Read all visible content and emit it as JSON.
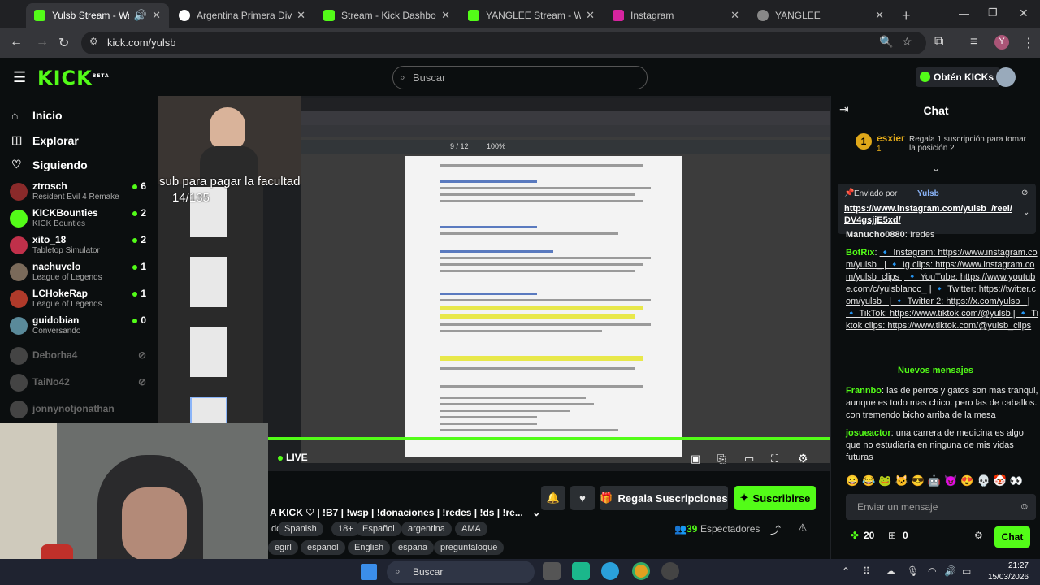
{
  "browser": {
    "tabs": [
      {
        "title": "Yulsb Stream - Watch L",
        "active": true
      },
      {
        "title": "Argentina Primera Division"
      },
      {
        "title": "Stream - Kick Dashboard"
      },
      {
        "title": "YANGLEE Stream - Watch L"
      },
      {
        "title": "Instagram"
      },
      {
        "title": "YANGLEE"
      }
    ],
    "new_tab": "+",
    "url": "kick.com/yulsb",
    "profile_initial": "Y"
  },
  "header": {
    "logo": "KICK",
    "logo_beta": "BETA",
    "search_placeholder": "Buscar",
    "get_kicks": "Obtén KICKs"
  },
  "sidebar": {
    "nav": [
      {
        "label": "Inicio",
        "icon": "home-icon"
      },
      {
        "label": "Explorar",
        "icon": "compass-icon"
      },
      {
        "label": "Siguiendo",
        "icon": "heart-icon"
      }
    ],
    "channels": [
      {
        "name": "ztrosch",
        "game": "Resident Evil 4 Remake",
        "viewers": "6",
        "color": "#8a2a2a"
      },
      {
        "name": "KICKBounties",
        "game": "KICK Bounties",
        "viewers": "2",
        "color": "#53fc18"
      },
      {
        "name": "xito_18",
        "game": "Tabletop Simulator",
        "viewers": "2",
        "color": "#c0304a"
      },
      {
        "name": "nachuvelo",
        "game": "League of Legends",
        "viewers": "1",
        "color": "#7a6a5a"
      },
      {
        "name": "LCHokeRap",
        "game": "League of Legends",
        "viewers": "1",
        "color": "#b03a2a"
      },
      {
        "name": "guidobian",
        "game": "Conversando",
        "viewers": "0",
        "color": "#5a8a9a"
      }
    ],
    "offline": [
      "Deborha4",
      "TaiNo42",
      "jonnynotjonathan"
    ]
  },
  "stream": {
    "overlay_text": "sub para pagar la facultad",
    "overlay_count": "14/135",
    "pdf_page": "9 / 12",
    "pdf_zoom": "100%",
    "live_label": "LIVE",
    "title": "A KICK ♡ | !B7 | !wsp | !donaciones | !redes | !ds | !re...",
    "tags_row1": [
      "do",
      "Spanish",
      "18+",
      "Español",
      "argentina",
      "AMA"
    ],
    "tags_row2": [
      "egirl",
      "espanol",
      "English",
      "espana",
      "preguntaloque"
    ],
    "gift_subs": "Regala Suscripciones",
    "subscribe": "Suscribirse",
    "viewers": "39",
    "viewers_label": "Espectadores"
  },
  "chat": {
    "title": "Chat",
    "top_gifter_rank": "1",
    "top_gifter_name": "esxier",
    "top_gifter_count": "1",
    "gift_prompt": "Regala 1 suscripción para tomar la posición 2",
    "pinned_by": "Enviado por",
    "pinned_user": "Yulsb",
    "pinned_link": "https://www.instagram.com/yulsb_/reel/DV4gsjjE5xd/",
    "messages": [
      {
        "user": "Manucho0880",
        "text": "!redes",
        "color": "#e6e6e6"
      },
      {
        "user": "BotRix",
        "text": "🔹 Instagram: https://www.instagram.com/yulsb_ | 🔹 Ig clips: https://www.instagram.com/yulsb_clips | 🔹 YouTube: https://www.youtube.com/c/yulsblanco_ | 🔹 Twitter: https://twitter.com/yulsb_ | 🔹 Twitter 2: https://x.com/yulsb_ | 🔹 TikTok: https://www.tiktok.com/@yulsb | 🔹 Tiktok clips: https://www.tiktok.com/@yulsb_clips",
        "color": "#53fc18"
      },
      {
        "user": "Frannbo",
        "text": "las de perros y gatos son mas tranqui, aunque es todo mas chico. pero las de caballos. con tremendo bicho arriba de la mesa",
        "color": "#53fc18"
      },
      {
        "user": "josueactor",
        "text": "una carrera de medicina es algo que no estudiaría en ninguna de mis vidas futuras",
        "color": "#53fc18"
      }
    ],
    "new_messages": "Nuevos mensajes",
    "input_placeholder": "Enviar un mensaje",
    "points": "20",
    "gifts": "0",
    "send": "Chat"
  },
  "taskbar": {
    "search": "Buscar",
    "time": "21:27",
    "date": "15/03/2026"
  },
  "colors": {
    "accent": "#53fc18",
    "bg": "#0b0e0f"
  }
}
